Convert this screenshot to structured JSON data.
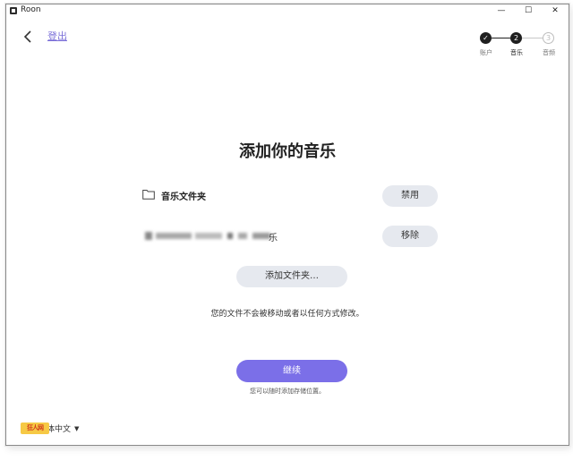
{
  "window": {
    "title": "Roon",
    "minimize_glyph": "—",
    "maximize_glyph": "☐",
    "close_glyph": "✕"
  },
  "header": {
    "back_icon": "chevron-left-icon",
    "logout_label": "登出"
  },
  "stepper": {
    "current_step": 2,
    "steps": [
      {
        "number": "✓",
        "label": "账户",
        "state": "done"
      },
      {
        "number": "2",
        "label": "音乐",
        "state": "current"
      },
      {
        "number": "3",
        "label": "音频",
        "state": "upcoming"
      }
    ]
  },
  "main": {
    "title": "添加你的音乐",
    "folders": [
      {
        "name": "音乐文件夹",
        "icon": "folder-icon",
        "action_label": "禁用"
      },
      {
        "name_visible_suffix": "乐",
        "name_obscured": true,
        "action_label": "移除"
      }
    ],
    "add_folder_label": "添加文件夹…",
    "note": "您的文件不会被移动或者以任何方式修改。",
    "continue_label": "继续",
    "subnote": "您可以随时添加存储位置。"
  },
  "footer": {
    "language_label": "体中文",
    "language_badge": "狂人网",
    "caret_icon": "caret-down-icon"
  },
  "colors": {
    "accent": "#7b6fe8",
    "link": "#7b6fd8",
    "pill_bg": "#e6e9ef",
    "step_done": "#1f1f1f"
  }
}
